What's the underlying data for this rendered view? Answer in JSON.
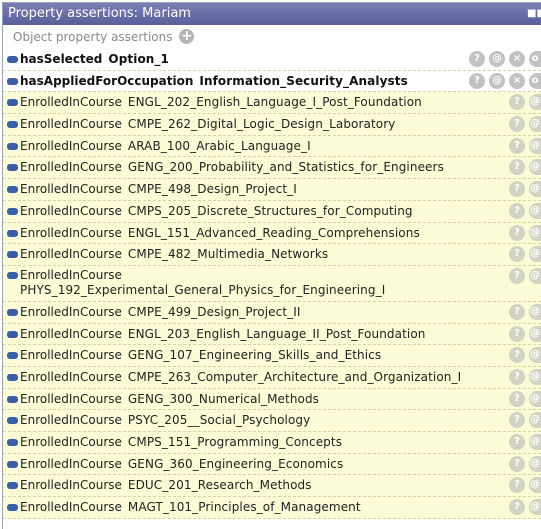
{
  "panel": {
    "title": "Property assertions: Mariam",
    "title_ctrl": "■■"
  },
  "section": {
    "label": "Object property assertions",
    "add_symbol": "+"
  },
  "buttons": {
    "help": "?",
    "annot": "@",
    "delete": "×",
    "edit": "o"
  },
  "assertions": [
    {
      "property": "hasSelected",
      "value": "Option_1",
      "style": "plain"
    },
    {
      "property": "hasAppliedForOccupation",
      "value": "Information_Security_Analysts",
      "style": "plain"
    },
    {
      "property": "EnrolledInCourse",
      "value": "ENGL_202_English_Language_I_Post_Foundation",
      "style": "yellow"
    },
    {
      "property": "EnrolledInCourse",
      "value": "CMPE_262_Digital_Logic_Design_Laboratory",
      "style": "yellow"
    },
    {
      "property": "EnrolledInCourse",
      "value": "ARAB_100_Arabic_Language_I",
      "style": "yellow"
    },
    {
      "property": "EnrolledInCourse",
      "value": "GENG_200_Probability_and_Statistics_for_Engineers",
      "style": "yellow"
    },
    {
      "property": "EnrolledInCourse",
      "value": "CMPE_498_Design_Project_I",
      "style": "yellow"
    },
    {
      "property": "EnrolledInCourse",
      "value": "CMPS_205_Discrete_Structures_for_Computing",
      "style": "yellow"
    },
    {
      "property": "EnrolledInCourse",
      "value": "ENGL_151_Advanced_Reading_Comprehensions",
      "style": "yellow"
    },
    {
      "property": "EnrolledInCourse",
      "value": "CMPE_482_Multimedia_Networks",
      "style": "yellow"
    },
    {
      "property": "EnrolledInCourse",
      "value": "PHYS_192_Experimental_General_Physics_for_Engineering_I",
      "style": "yellow tall"
    },
    {
      "property": "EnrolledInCourse",
      "value": "CMPE_499_Design_Project_II",
      "style": "yellow"
    },
    {
      "property": "EnrolledInCourse",
      "value": "ENGL_203_English_Language_II_Post_Foundation",
      "style": "yellow"
    },
    {
      "property": "EnrolledInCourse",
      "value": "GENG_107_Engineering_Skills_and_Ethics",
      "style": "yellow"
    },
    {
      "property": "EnrolledInCourse",
      "value": "CMPE_263_Computer_Architecture_and_Organization_I",
      "style": "yellow"
    },
    {
      "property": "EnrolledInCourse",
      "value": "GENG_300_Numerical_Methods",
      "style": "yellow"
    },
    {
      "property": "EnrolledInCourse",
      "value": "PSYC_205__Social_Psychology",
      "style": "yellow"
    },
    {
      "property": "EnrolledInCourse",
      "value": "CMPS_151_Programming_Concepts",
      "style": "yellow"
    },
    {
      "property": "EnrolledInCourse",
      "value": "GENG_360_Engineering_Economics",
      "style": "yellow"
    },
    {
      "property": "EnrolledInCourse",
      "value": "EDUC_201_Research_Methods",
      "style": "yellow"
    },
    {
      "property": "EnrolledInCourse",
      "value": "MAGT_101_Principles_of_Management",
      "style": "yellow"
    }
  ]
}
